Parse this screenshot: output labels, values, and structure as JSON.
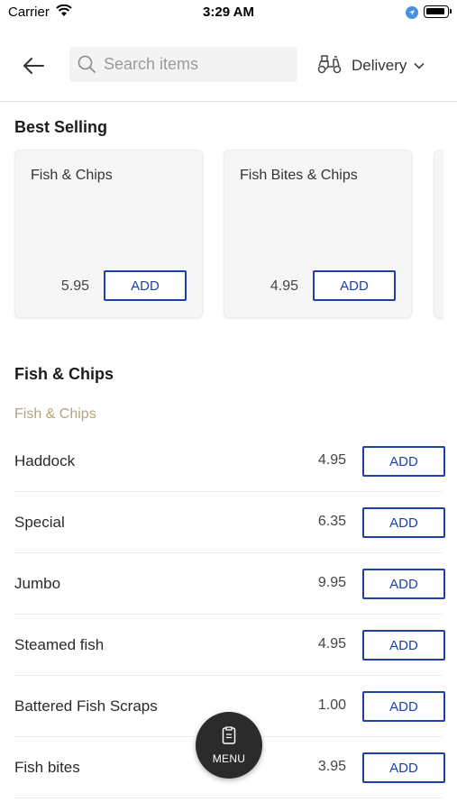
{
  "status_bar": {
    "carrier": "Carrier",
    "time": "3:29 AM"
  },
  "header": {
    "search_placeholder": "Search items",
    "delivery_label": "Delivery"
  },
  "best_selling": {
    "title": "Best Selling",
    "cards": [
      {
        "name": "Fish & Chips",
        "price": "5.95",
        "button": "ADD"
      },
      {
        "name": "Fish Bites & Chips",
        "price": "4.95",
        "button": "ADD"
      }
    ]
  },
  "category": {
    "title": "Fish & Chips",
    "subtitle": "Fish & Chips",
    "items": [
      {
        "name": "Haddock",
        "price": "4.95",
        "button": "ADD"
      },
      {
        "name": "Special",
        "price": "6.35",
        "button": "ADD"
      },
      {
        "name": "Jumbo",
        "price": "9.95",
        "button": "ADD"
      },
      {
        "name": "Steamed fish",
        "price": "4.95",
        "button": "ADD"
      },
      {
        "name": "Battered Fish Scraps",
        "price": "1.00",
        "button": "ADD"
      },
      {
        "name": "Fish bites",
        "price": "3.95",
        "button": "ADD"
      }
    ]
  },
  "menu_fab": {
    "label": "MENU"
  },
  "colors": {
    "accent": "#1d3fa8",
    "subtitle": "#b1a57d",
    "fab": "#2b2b2b"
  },
  "icons": [
    "wifi-icon",
    "location-arrow-icon",
    "battery-icon",
    "back-arrow-icon",
    "search-icon",
    "scooter-icon",
    "chevron-down-icon",
    "menu-icon"
  ]
}
